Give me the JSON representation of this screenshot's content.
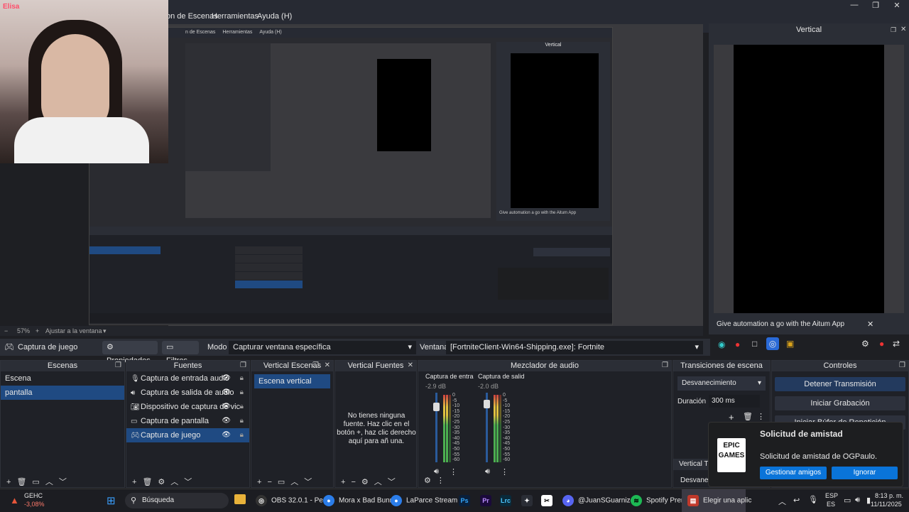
{
  "menu": {
    "items": [
      "on de Escenas",
      "Herramientas",
      "Ayuda (H)"
    ],
    "window_controls": [
      "—",
      "❐",
      "✕"
    ]
  },
  "preview": {
    "mirror_menu": [
      "n de Escenas",
      "Herramientas",
      "Ayuda (H)"
    ],
    "mirror_vertical_title": "Vertical",
    "mirror_automation": "Give automation a go with the Aitum App",
    "zoom": "57%",
    "fit_label": "Ajustar a la ventana"
  },
  "webcam": {
    "logo": "Elisa"
  },
  "vertical": {
    "title": "Vertical",
    "automation_text": "Give automation a go with the Aitum App"
  },
  "propbar": {
    "source_name": "Captura de juego",
    "properties_label": "Propiedades",
    "filters_label": "Filtros",
    "mode_label": "Modo",
    "mode_value": "Capturar ventana específica",
    "window_label": "Ventana",
    "window_value": "[FortniteClient-Win64-Shipping.exe]: Fortnite"
  },
  "scenes": {
    "title": "Escenas",
    "items": [
      {
        "label": "Escena",
        "selected": false
      },
      {
        "label": "pantalla",
        "selected": true
      }
    ]
  },
  "sources": {
    "title": "Fuentes",
    "items": [
      {
        "label": "Captura de entrada audio",
        "icon": "microphone-icon",
        "selected": false
      },
      {
        "label": "Captura de salida de audio",
        "icon": "speaker-icon",
        "selected": false
      },
      {
        "label": "Dispositivo de captura de vic",
        "icon": "camera-icon",
        "selected": false
      },
      {
        "label": "Captura de pantalla",
        "icon": "monitor-icon",
        "selected": false
      },
      {
        "label": "Captura de juego",
        "icon": "gamepad-icon",
        "selected": true
      }
    ]
  },
  "vertical_scenes": {
    "title": "Vertical Escenas",
    "items": [
      {
        "label": "Escena vertical",
        "selected": true
      }
    ]
  },
  "vertical_sources": {
    "title": "Vertical Fuentes",
    "empty_text": "No tienes ninguna fuente. Haz clic en el botón +, haz clic derecho aquí para añ una."
  },
  "mixer": {
    "title": "Mezclador de audio",
    "channels": [
      {
        "name": "Captura de entra",
        "db": "-2.9 dB"
      },
      {
        "name": "Captura de salid",
        "db": "-2.0 dB"
      }
    ],
    "ticks": [
      "0",
      "-5",
      "-10",
      "-15",
      "-20",
      "-25",
      "-30",
      "-35",
      "-40",
      "-45",
      "-50",
      "-55",
      "-60"
    ]
  },
  "transitions": {
    "title": "Transiciones de escena",
    "selected": "Desvanecimiento",
    "duration_label": "Duración",
    "duration_value": "300 ms",
    "vertical_tab": "Vertical Tr",
    "vertical_selected": "Desvanec"
  },
  "controls": {
    "title": "Controles",
    "buttons": [
      "Detener Transmisión",
      "Iniciar Grabación",
      "Iniciar Búfer de Repetición"
    ]
  },
  "notification": {
    "logo": "EPIC GAMES",
    "title": "Solicitud de amistad",
    "body": "Solicitud de amistad de OGPaulo.",
    "primary": "Gestionar amigos",
    "secondary": "Ignorar"
  },
  "taskbar": {
    "ticker": "GEHC",
    "ticker_change": "-3,08%",
    "search_placeholder": "Búsqueda",
    "apps": [
      {
        "label": "OBS 32.0.1 - Perfi",
        "color": "#3a3a3a"
      },
      {
        "label": "Mora x Bad Bunn",
        "color": "#3a3a3a"
      },
      {
        "label": "LaParce Stream -",
        "color": "#3a3a3a"
      },
      {
        "label": "@JuanSGuarnizo",
        "color": "#5865f2"
      },
      {
        "label": "Spotify Prem",
        "color": "#1db954"
      },
      {
        "label": "Elegir una aplic",
        "color": "#c0392b"
      }
    ],
    "lang": "ESP",
    "lang_sub": "ES",
    "time": "8:13 p. m.",
    "date": "11/11/2025"
  },
  "colors": {
    "accent": "#1f4a82",
    "epic_button": "#0a74d9",
    "bg_panel": "#1f2127"
  }
}
